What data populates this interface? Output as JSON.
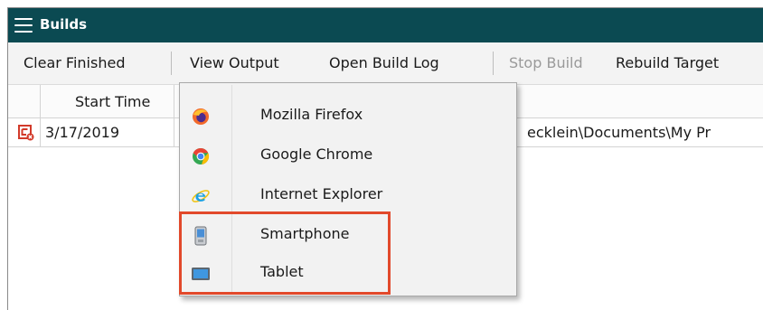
{
  "window": {
    "title": "Builds"
  },
  "toolbar": {
    "clear_finished": "Clear Finished",
    "view_output": "View Output",
    "open_build_log": "Open Build Log",
    "stop_build": "Stop Build",
    "rebuild_target": "Rebuild Target"
  },
  "grid": {
    "columns": [
      "Start Time"
    ],
    "rows": [
      {
        "start_time": "3/17/2019",
        "path": "ecklein\\Documents\\My Pr"
      }
    ]
  },
  "menu": {
    "items": [
      {
        "label": "Mozilla Firefox",
        "icon": "firefox-icon"
      },
      {
        "label": "Google Chrome",
        "icon": "chrome-icon"
      },
      {
        "label": "Internet Explorer",
        "icon": "internet-explorer-icon"
      },
      {
        "label": "Smartphone",
        "icon": "smartphone-icon"
      },
      {
        "label": "Tablet",
        "icon": "tablet-icon"
      }
    ]
  },
  "colors": {
    "titlebar": "#0b4a52",
    "highlight": "#e2492b",
    "menu_background": "#f2f2f2"
  }
}
